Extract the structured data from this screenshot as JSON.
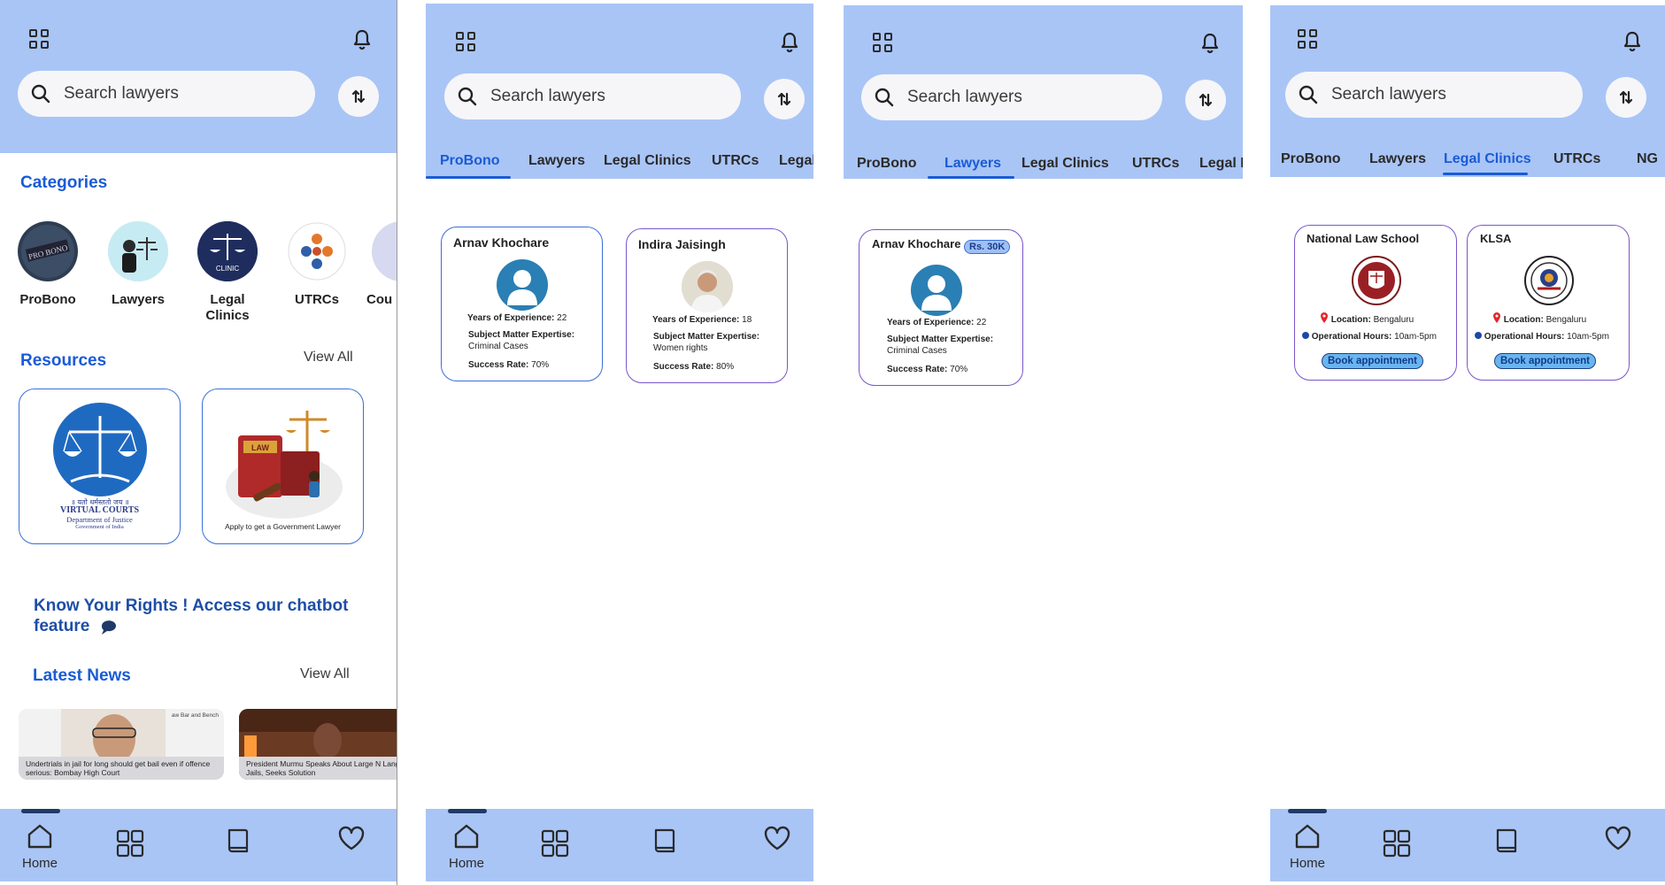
{
  "app": {
    "search_placeholder": "Search lawyers",
    "accent": "#1a5bd6",
    "header_bg": "#a9c5f6"
  },
  "home": {
    "categories_title": "Categories",
    "categories": [
      {
        "label": "ProBono",
        "icon": "probono-icon"
      },
      {
        "label": "Lawyers",
        "icon": "lawyer-icon"
      },
      {
        "label": "Legal Clinics",
        "icon": "clinic-icon"
      },
      {
        "label": "UTRCs",
        "icon": "utrc-icon"
      },
      {
        "label": "Cou",
        "icon": "court-icon"
      }
    ],
    "resources_title": "Resources",
    "resources_view_all": "View All",
    "resources": [
      {
        "title": "VIRTUAL COURTS",
        "line2": "Department of Justice",
        "line3": "Government of India",
        "motto": "॥ यतो धर्मस्ततो जय ॥"
      },
      {
        "caption": "Apply to get a Government Lawyer",
        "book_text": "LAW"
      }
    ],
    "chatbot_text": "Know Your Rights !  Access our chatbot feature",
    "news_title": "Latest News",
    "news_view_all": "View All",
    "news": [
      {
        "caption": "Undertrials in jail for long should get bail even if offence serious: Bombay High Court",
        "source": "aw Bar and Bench"
      },
      {
        "caption": "President Murmu Speaks About Large N Languishing In Jails, Seeks Solution"
      }
    ]
  },
  "tabs": [
    "ProBono",
    "Lawyers",
    "Legal Clinics",
    "UTRCs",
    "Legal"
  ],
  "tabs_clinic": [
    "ProBono",
    "Lawyers",
    "Legal Clinics",
    "UTRCs",
    "NGO"
  ],
  "tabs_lawyers_partial": "Legal F",
  "tabs_clinic_partial": "NG",
  "probono_cards": [
    {
      "name": "Arnav Khochare",
      "exp_label": "Years of Experience:",
      "exp": "22",
      "sme_label": "Subject Matter Expertise:",
      "sme": "Criminal Cases",
      "rate_label": "Success Rate:",
      "rate": "70%"
    },
    {
      "name": "Indira Jaisingh",
      "exp_label": "Years of Experience:",
      "exp": "18",
      "sme_label": "Subject Matter Expertise:",
      "sme": "Women rights",
      "rate_label": "Success Rate:",
      "rate": "80%"
    }
  ],
  "lawyer_cards": [
    {
      "name": "Arnav Khochare",
      "fee": "Rs. 30K",
      "exp_label": "Years of Experience:",
      "exp": "22",
      "sme_label": "Subject Matter Expertise:",
      "sme": "Criminal Cases",
      "rate_label": "Success Rate:",
      "rate": "70%"
    }
  ],
  "clinic_cards": [
    {
      "name": "National Law School",
      "loc_label": "Location:",
      "loc": "Bengaluru",
      "hours_label": "Operational Hours:",
      "hours": "10am-5pm",
      "button": "Book appointment"
    },
    {
      "name": "KLSA",
      "loc_label": "Location:",
      "loc": "Bengaluru",
      "hours_label": "Operational Hours:",
      "hours": "10am-5pm",
      "button": "Book appointment"
    }
  ],
  "bottom_nav": {
    "home_label": "Home",
    "icons": [
      "home-icon",
      "grid-icon",
      "book-icon",
      "heart-icon"
    ]
  }
}
